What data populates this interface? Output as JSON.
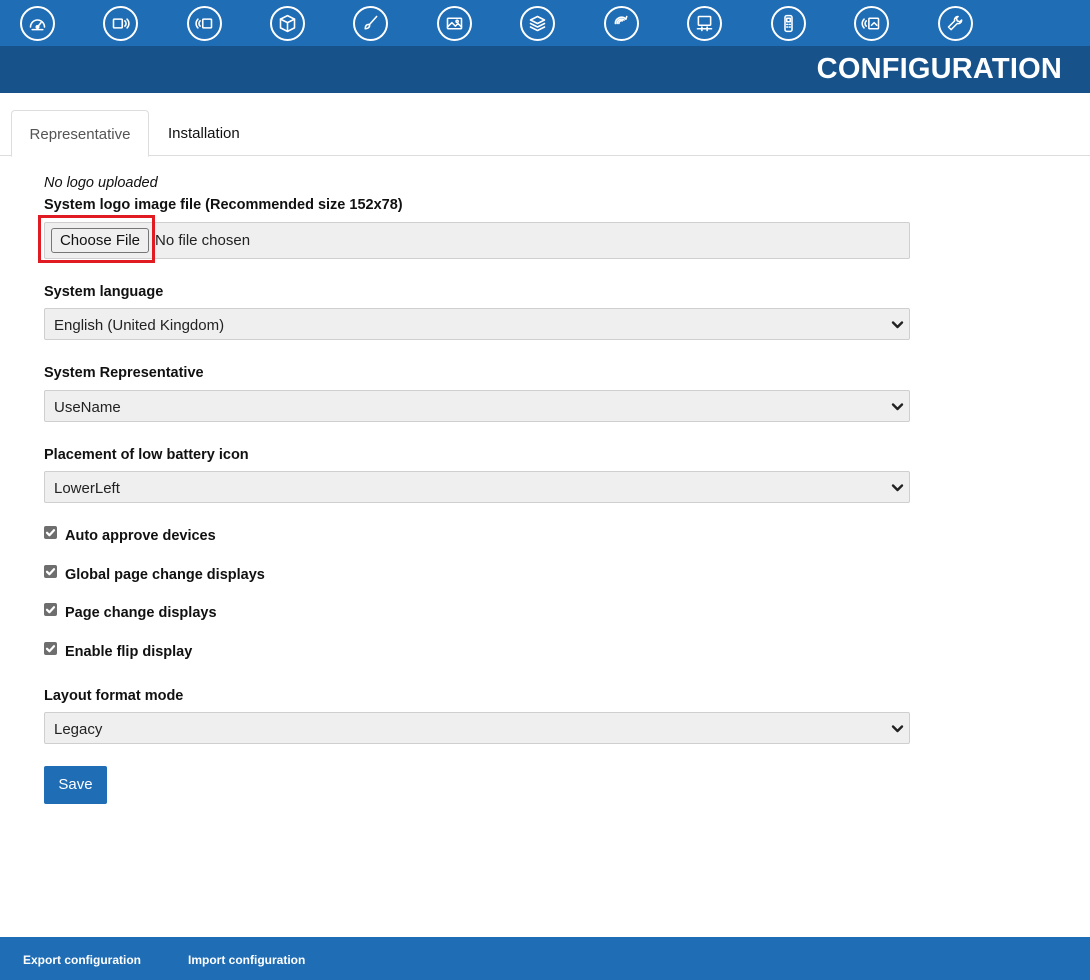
{
  "header": {
    "title": "CONFIGURATION",
    "nav_icons": [
      "dashboard-icon",
      "device-signal-icon",
      "wireless-device-icon",
      "package-icon",
      "brush-icon",
      "images-icon",
      "layers-icon",
      "refresh-signal-icon",
      "monitor-4k-icon",
      "handheld-device-icon",
      "wireless-display-icon",
      "wrench-icon"
    ]
  },
  "tabs": [
    {
      "label": "Representative",
      "active": true
    },
    {
      "label": "Installation",
      "active": false
    }
  ],
  "form": {
    "logo_status": "No logo uploaded",
    "logo_label": "System logo image file (Recommended size 152x78)",
    "file_button": "Choose File",
    "file_name": "No file chosen",
    "language_label": "System language",
    "language_value": "English (United Kingdom)",
    "representative_label": "System Representative",
    "representative_value": "UseName",
    "battery_label": "Placement of low battery icon",
    "battery_value": "LowerLeft",
    "checkboxes": [
      {
        "label": "Auto approve devices",
        "checked": true
      },
      {
        "label": "Global page change displays",
        "checked": true
      },
      {
        "label": "Page change displays",
        "checked": true
      },
      {
        "label": "Enable flip display",
        "checked": true
      }
    ],
    "layout_label": "Layout format mode",
    "layout_value": "Legacy",
    "save_label": "Save"
  },
  "footer": {
    "export_label": "Export configuration",
    "import_label": "Import configuration"
  },
  "colors": {
    "primary": "#1f6db5",
    "title_band": "#17528b",
    "highlight": "#e11b22"
  }
}
